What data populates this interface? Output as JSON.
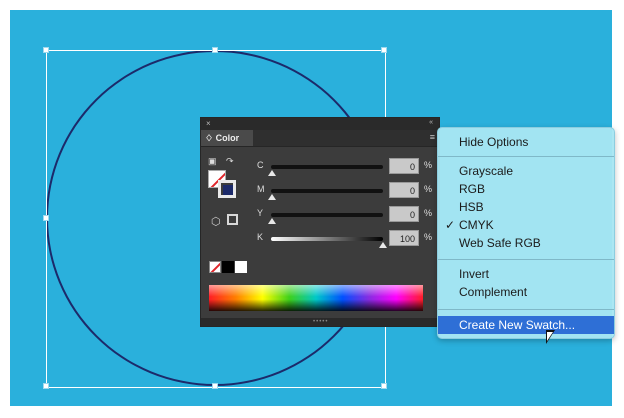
{
  "panel": {
    "tab_label": "♢ Color",
    "close_glyph": "×",
    "collapse_glyph": "«",
    "menu_glyph": "≡",
    "sliders": [
      {
        "label": "C",
        "value": "0",
        "unit": "%"
      },
      {
        "label": "M",
        "value": "0",
        "unit": "%"
      },
      {
        "label": "Y",
        "value": "0",
        "unit": "%"
      },
      {
        "label": "K",
        "value": "100",
        "unit": "%"
      }
    ]
  },
  "menu": {
    "items": [
      {
        "label": "Hide Options"
      },
      {
        "label": "Grayscale"
      },
      {
        "label": "RGB"
      },
      {
        "label": "HSB"
      },
      {
        "label": "CMYK",
        "checked": true
      },
      {
        "label": "Web Safe RGB"
      },
      {
        "label": "Invert"
      },
      {
        "label": "Complement"
      },
      {
        "label": "Create New Swatch..."
      }
    ],
    "check_glyph": "✓"
  },
  "colors": {
    "artboard": "#2ab0dc",
    "circle_stroke": "#1c2a6a",
    "menu_highlight": "#2e6fd6"
  }
}
